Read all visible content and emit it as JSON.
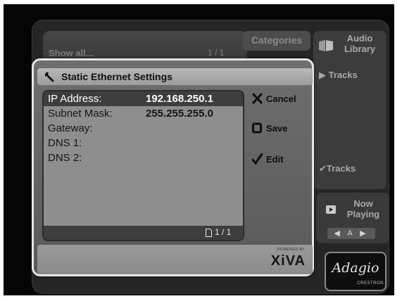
{
  "background": {
    "list_header": "Show all...",
    "list_page": "1 / 1",
    "categories_tab": "Categories",
    "audio_library": "Audio Library",
    "tracks_top": "Tracks",
    "tracks_bottom": "Tracks",
    "now_playing": "Now Playing",
    "transport_source": "◀ A ▶",
    "brand_logo": "Adagio",
    "brand_subtitle": "CRESTRON"
  },
  "dialog": {
    "title": "Static Ethernet Settings",
    "fields": [
      {
        "label": "IP Address:",
        "value": "192.168.250.1",
        "selected": true
      },
      {
        "label": "Subnet Mask:",
        "value": "255.255.255.0",
        "selected": false
      },
      {
        "label": "Gateway:",
        "value": "",
        "selected": false
      },
      {
        "label": "DNS 1:",
        "value": "",
        "selected": false
      },
      {
        "label": "DNS 2:",
        "value": "",
        "selected": false
      }
    ],
    "page_indicator": "1 / 1",
    "actions": {
      "cancel": "Cancel",
      "save": "Save",
      "edit": "Edit"
    },
    "powered_by": "POWERED BY",
    "xiva_logo": "XiVA"
  },
  "icons": {
    "title": "wrench-icon",
    "cancel": "x-icon",
    "save": "square-icon",
    "edit": "checkmark-icon",
    "page": "page-icon",
    "audio_library": "speaker-book-icon",
    "now_playing": "play-icon"
  },
  "colors": {
    "screen_bg": "#050505",
    "dialog_border": "#e6e6e6",
    "dialog_body": "#6e6e6e",
    "field_panel": "#8e8e8e",
    "selected_row": "#3e3e3e"
  }
}
